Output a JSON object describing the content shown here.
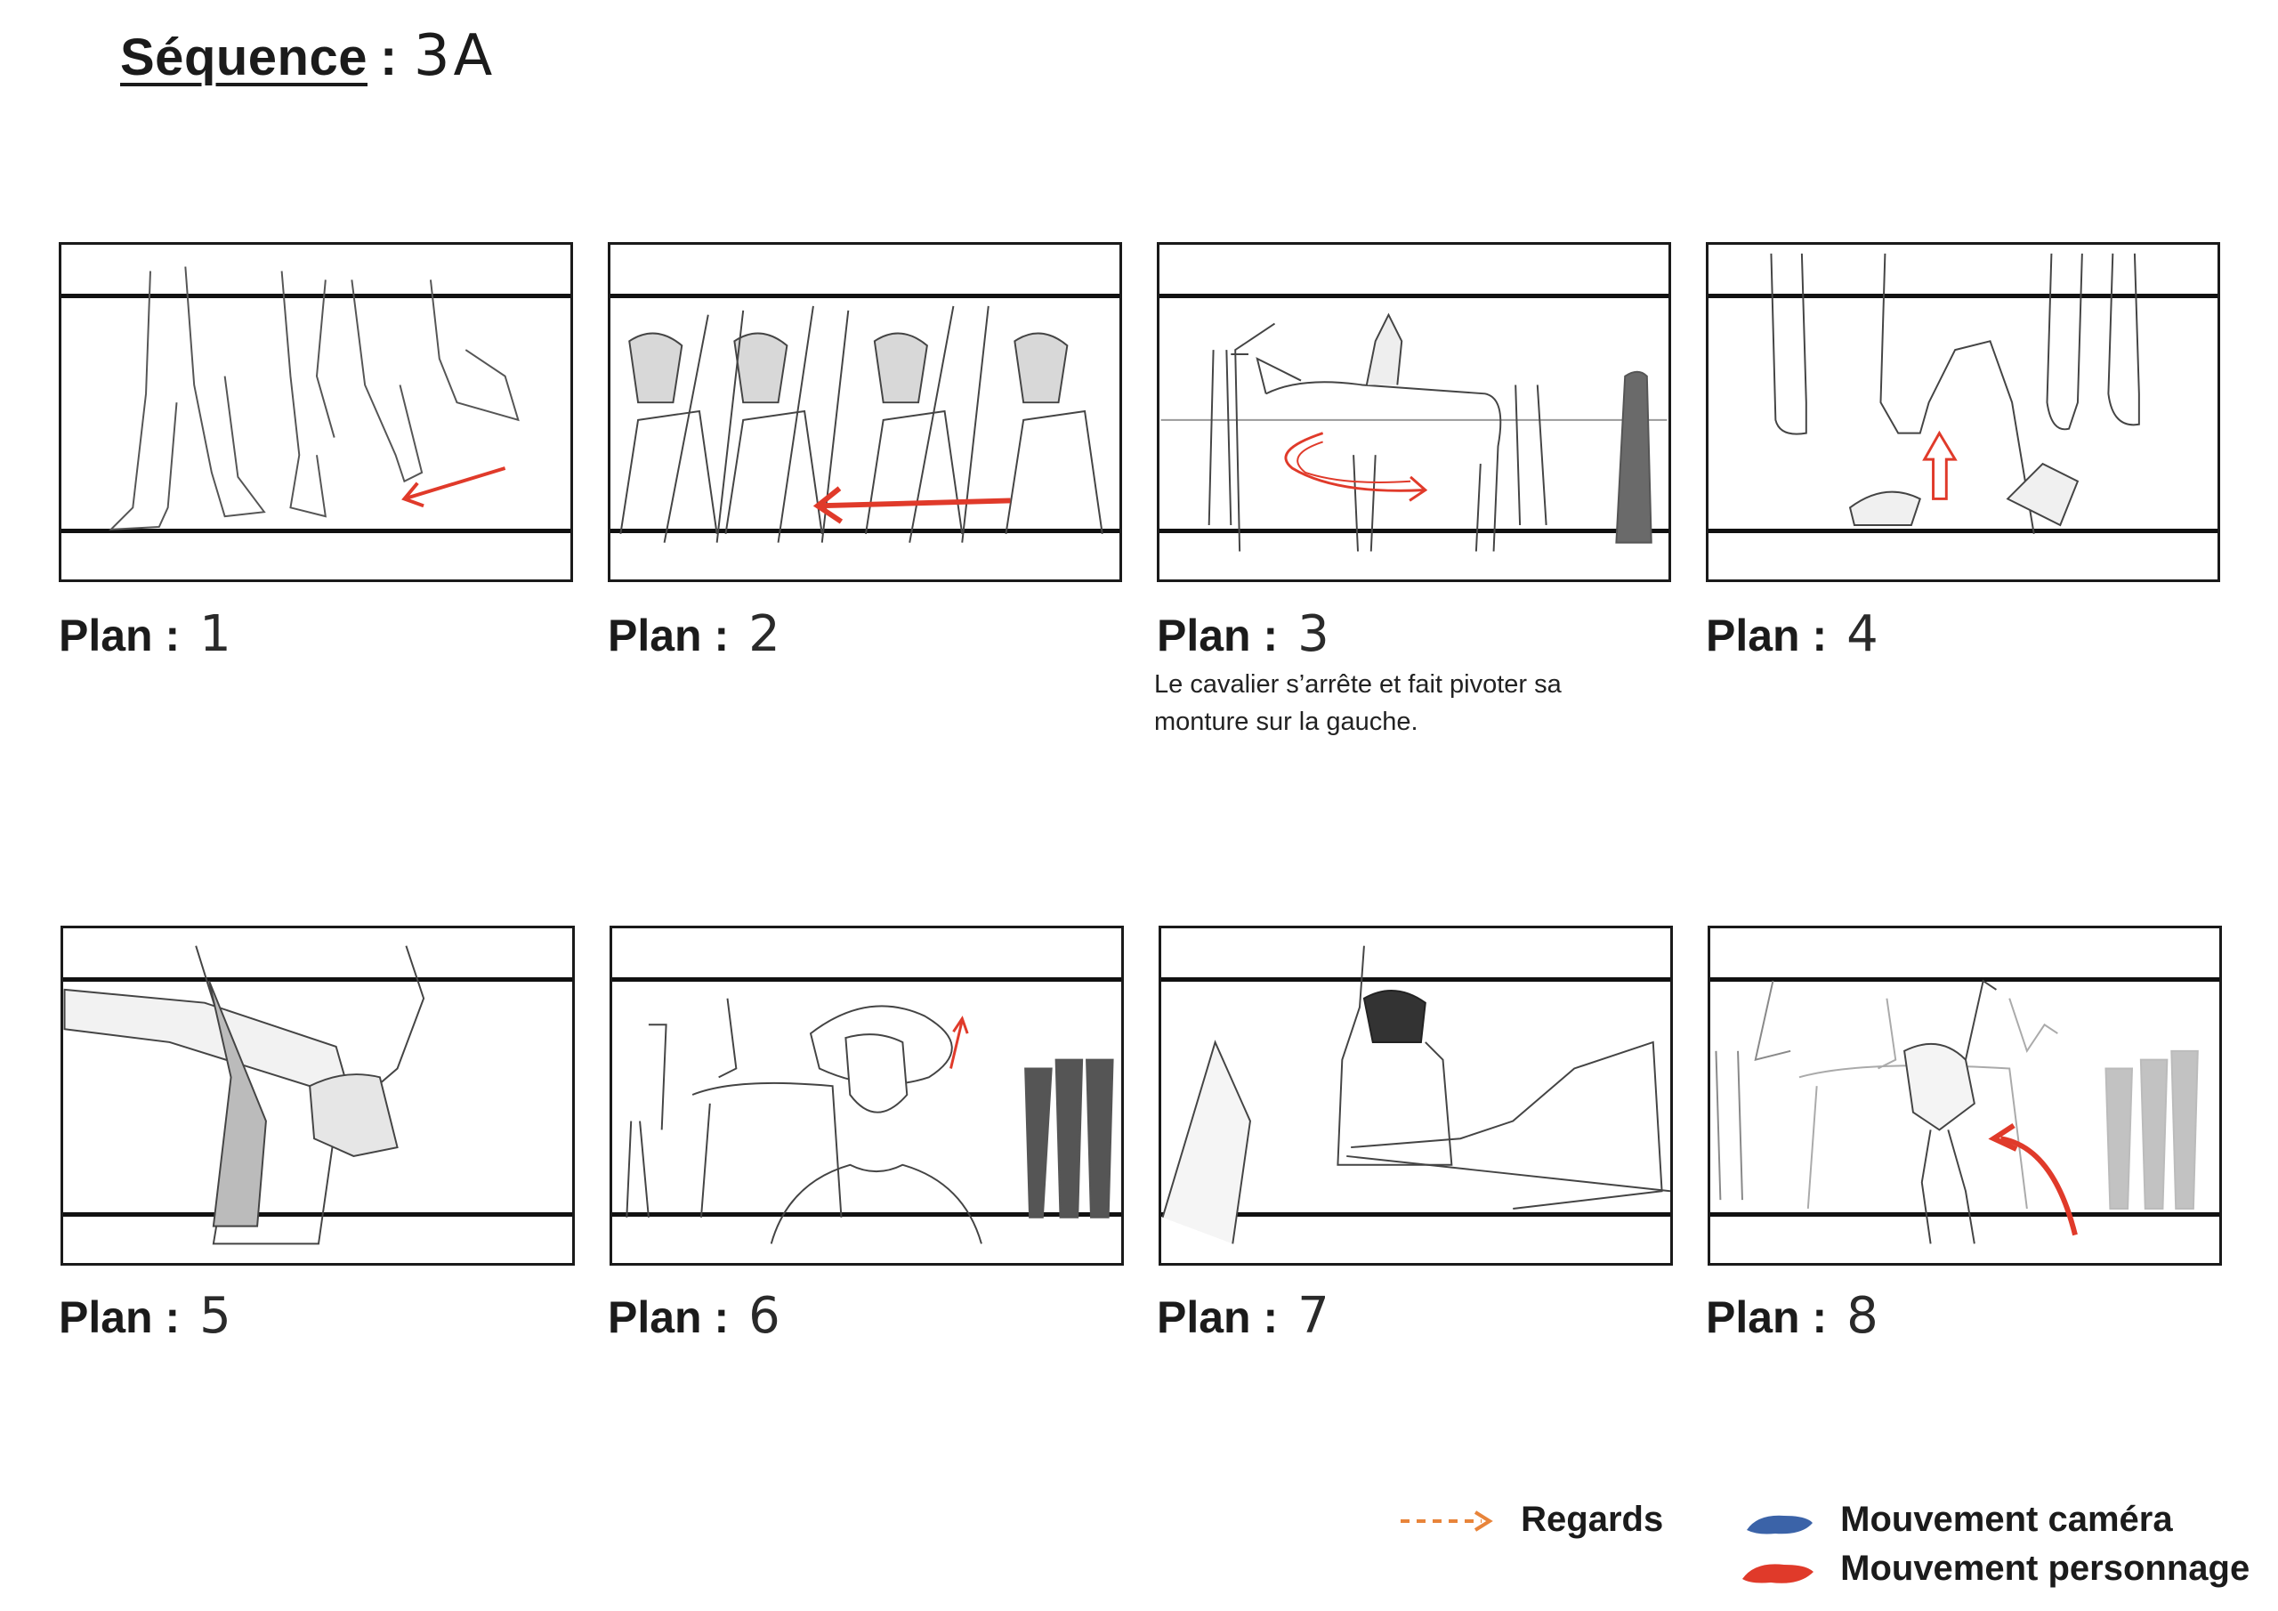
{
  "sequence": {
    "label": "Séquence",
    "colon": ":",
    "value": "3A"
  },
  "plan_prefix": "Plan :",
  "plans": [
    {
      "number": "1",
      "note": ""
    },
    {
      "number": "2",
      "note": ""
    },
    {
      "number": "3",
      "note": "Le cavalier s’arrête et fait pivoter sa monture sur la gauche."
    },
    {
      "number": "4",
      "note": ""
    },
    {
      "number": "5",
      "note": ""
    },
    {
      "number": "6",
      "note": ""
    },
    {
      "number": "7",
      "note": ""
    },
    {
      "number": "8",
      "note": ""
    }
  ],
  "legend": {
    "regards": {
      "label": "Regards",
      "color": "#e8843a"
    },
    "camera": {
      "label": "Mouvement caméra",
      "color": "#3b63a8"
    },
    "personnage": {
      "label": "Mouvement personnage",
      "color": "#e03a2a"
    }
  }
}
